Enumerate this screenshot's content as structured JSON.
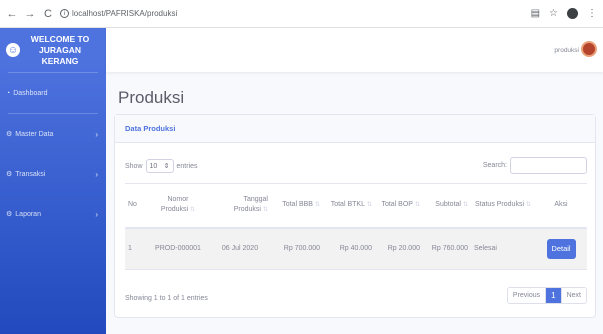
{
  "browser": {
    "url": "localhost/PAFRISKA/produksi",
    "back_icon": "arrow-left-icon",
    "forward_icon": "arrow-right-icon",
    "reload_icon": "reload-icon"
  },
  "sidebar": {
    "brand": "WELCOME TO JURAGAN KERANG",
    "brand_icon": "laugh-wink-icon",
    "items": [
      {
        "label": "Dashboard",
        "has_chevron": false
      },
      {
        "label": "Master Data",
        "has_chevron": true
      },
      {
        "label": "Transaksi",
        "has_chevron": true
      },
      {
        "label": "Laporan",
        "has_chevron": true
      }
    ]
  },
  "topbar": {
    "user_name": "produksi"
  },
  "page": {
    "title": "Produksi"
  },
  "card": {
    "title": "Data Produksi",
    "show_label": "Show",
    "show_value": "10",
    "entries_label": "entries",
    "search_label": "Search:",
    "search_value": "",
    "info": "Showing 1 to 1 of 1 entries"
  },
  "table": {
    "columns": [
      "No",
      "Nomor Produksi",
      "Tanggal Produksi",
      "Total BBB",
      "Total BTKL",
      "Total BOP",
      "Subtotal",
      "Status Produksi",
      "Aksi"
    ],
    "rows": [
      {
        "no": "1",
        "nomor": "PROD-000001",
        "tanggal": "06 Jul 2020",
        "bbb": "Rp 700.000",
        "btkl": "Rp 40.000",
        "bop": "Rp 20.000",
        "subtotal": "Rp 760.000",
        "status": "Selesai",
        "aksi": "Detail"
      }
    ]
  },
  "pagination": {
    "previous": "Previous",
    "page": "1",
    "next": "Next"
  },
  "colors": {
    "primary": "#4e73df",
    "sidebar_bottom": "#224abe",
    "text_muted": "#858796"
  }
}
